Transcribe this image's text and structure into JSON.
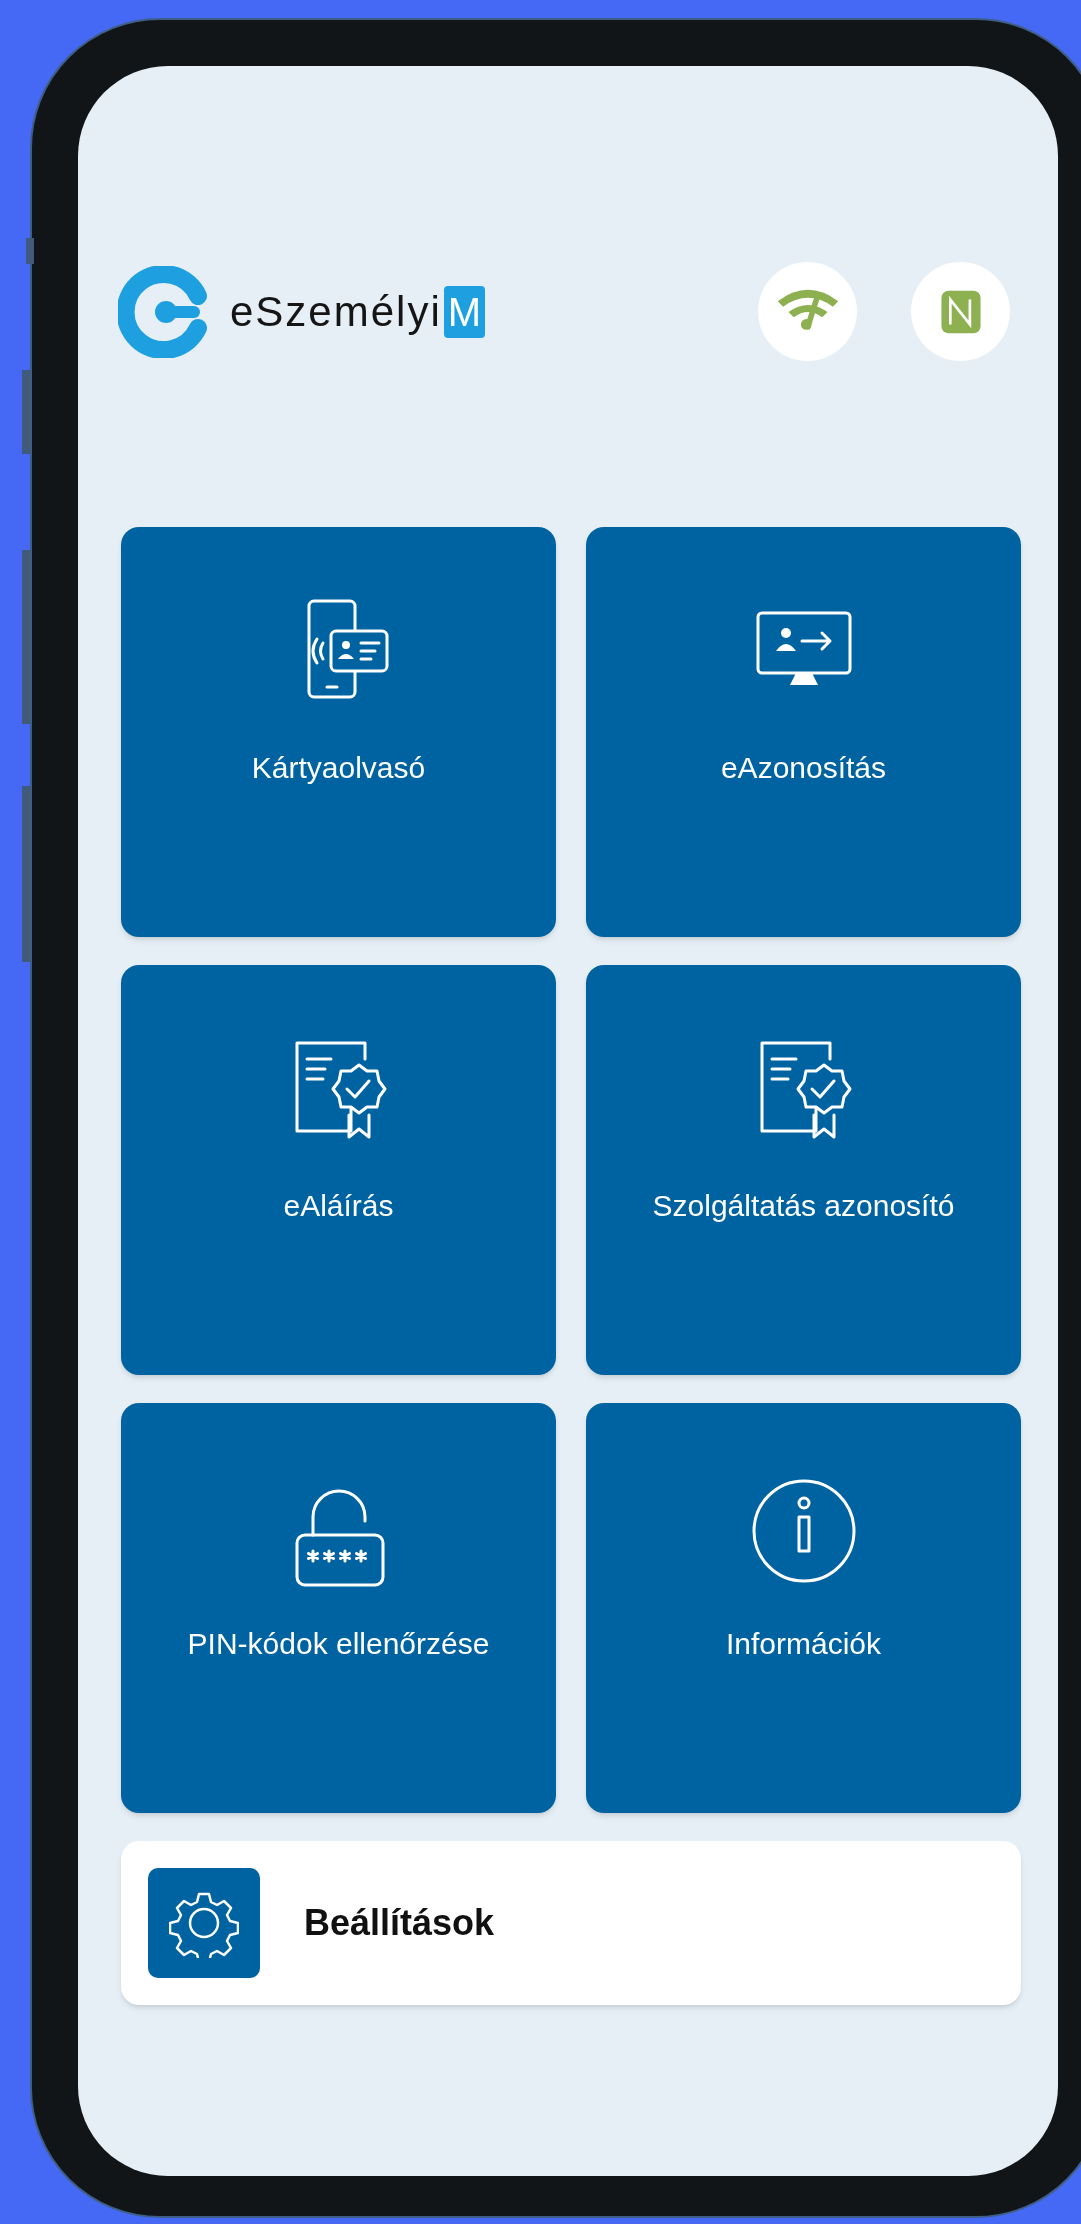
{
  "header": {
    "logo_text": "eSzemélyi",
    "logo_badge": "M"
  },
  "status_icons": [
    {
      "kind": "network"
    },
    {
      "kind": "nfc"
    }
  ],
  "tiles": [
    {
      "kind": "cardreader",
      "label": "Kártyaolvasó"
    },
    {
      "kind": "identify",
      "label": "eAzonosítás"
    },
    {
      "kind": "certificate",
      "label": "eAláírás"
    },
    {
      "kind": "certificate",
      "label": "Szolgáltatás azonosító"
    },
    {
      "kind": "pin",
      "label": "PIN-kódok ellenőrzése"
    },
    {
      "kind": "info",
      "label": "Információk"
    }
  ],
  "settings": {
    "label": "Beállítások"
  }
}
